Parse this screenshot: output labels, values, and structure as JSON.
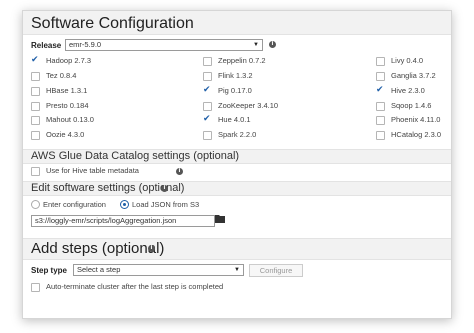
{
  "header": {
    "title": "Software Configuration"
  },
  "release": {
    "label": "Release",
    "value": "emr-5.9.0"
  },
  "applications": [
    {
      "name": "Hadoop 2.7.3",
      "checked": true
    },
    {
      "name": "Zeppelin 0.7.2",
      "checked": false
    },
    {
      "name": "Livy 0.4.0",
      "checked": false
    },
    {
      "name": "Tez 0.8.4",
      "checked": false
    },
    {
      "name": "Flink 1.3.2",
      "checked": false
    },
    {
      "name": "Ganglia 3.7.2",
      "checked": false
    },
    {
      "name": "HBase 1.3.1",
      "checked": false
    },
    {
      "name": "Pig 0.17.0",
      "checked": true
    },
    {
      "name": "Hive 2.3.0",
      "checked": true
    },
    {
      "name": "Presto 0.184",
      "checked": false
    },
    {
      "name": "ZooKeeper 3.4.10",
      "checked": false
    },
    {
      "name": "Sqoop 1.4.6",
      "checked": false
    },
    {
      "name": "Mahout 0.13.0",
      "checked": false
    },
    {
      "name": "Hue 4.0.1",
      "checked": true
    },
    {
      "name": "Phoenix 4.11.0",
      "checked": false
    },
    {
      "name": "Oozie 4.3.0",
      "checked": false
    },
    {
      "name": "Spark 2.2.0",
      "checked": false
    },
    {
      "name": "HCatalog 2.3.0",
      "checked": false
    }
  ],
  "glue": {
    "title": "AWS Glue Data Catalog settings (optional)",
    "option": "Use for Hive table metadata"
  },
  "edit": {
    "title": "Edit software settings (optional)",
    "radio_enter": "Enter configuration",
    "radio_load": "Load JSON from S3",
    "path": "s3://loggly-emr/scripts/logAggregation.json"
  },
  "steps": {
    "title": "Add steps (optional)",
    "step_type_label": "Step type",
    "step_select": "Select a step",
    "configure": "Configure",
    "auto_terminate": "Auto-terminate cluster after the last step is completed"
  },
  "icons": {
    "info": "info-icon",
    "folder": "folder-icon",
    "check": "checkmark-icon",
    "dropdown": "chevron-down-icon"
  }
}
